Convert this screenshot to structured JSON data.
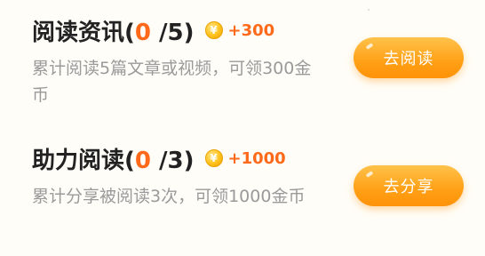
{
  "tasks": [
    {
      "title": "阅读资讯",
      "open": "(",
      "current": "0",
      "total": " /5)",
      "coin_symbol": "¥",
      "reward": "+300",
      "description": "累计阅读5篇文章或视频，可领300金币",
      "button": "去阅读"
    },
    {
      "title": "助力阅读",
      "open": "(",
      "current": "0",
      "total": " /3)",
      "coin_symbol": "¥",
      "reward": "+1000",
      "description": "累计分享被阅读3次，可领1000金币",
      "button": "去分享"
    }
  ],
  "colors": {
    "accent": "#ff6a1a",
    "button": "#ffa016",
    "title": "#222222",
    "description": "#9a9a9a"
  }
}
